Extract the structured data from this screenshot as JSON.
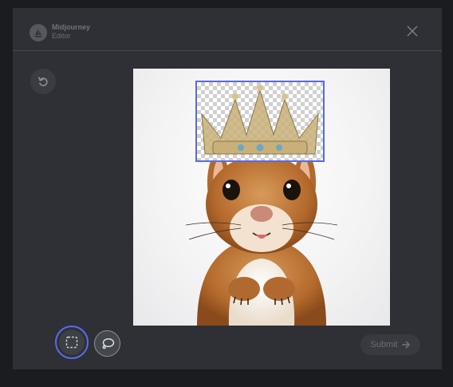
{
  "header": {
    "brand_name": "Midjourney",
    "brand_sub": "Editor",
    "logo_icon": "sailboat-icon",
    "close_icon": "close-icon"
  },
  "toolbar": {
    "undo_icon": "undo-icon",
    "rect_select_icon": "rectangle-select-icon",
    "lasso_icon": "lasso-icon",
    "rect_tool_active": true
  },
  "canvas": {
    "image_subject": "squirrel",
    "selection_active": true
  },
  "submit": {
    "label": "Submit",
    "icon": "arrow-right-icon"
  },
  "colors": {
    "modal_bg": "#2e3035",
    "page_bg": "#1b1c1f",
    "accent": "#5b6af0",
    "selection_border": "#5a6bdf"
  }
}
